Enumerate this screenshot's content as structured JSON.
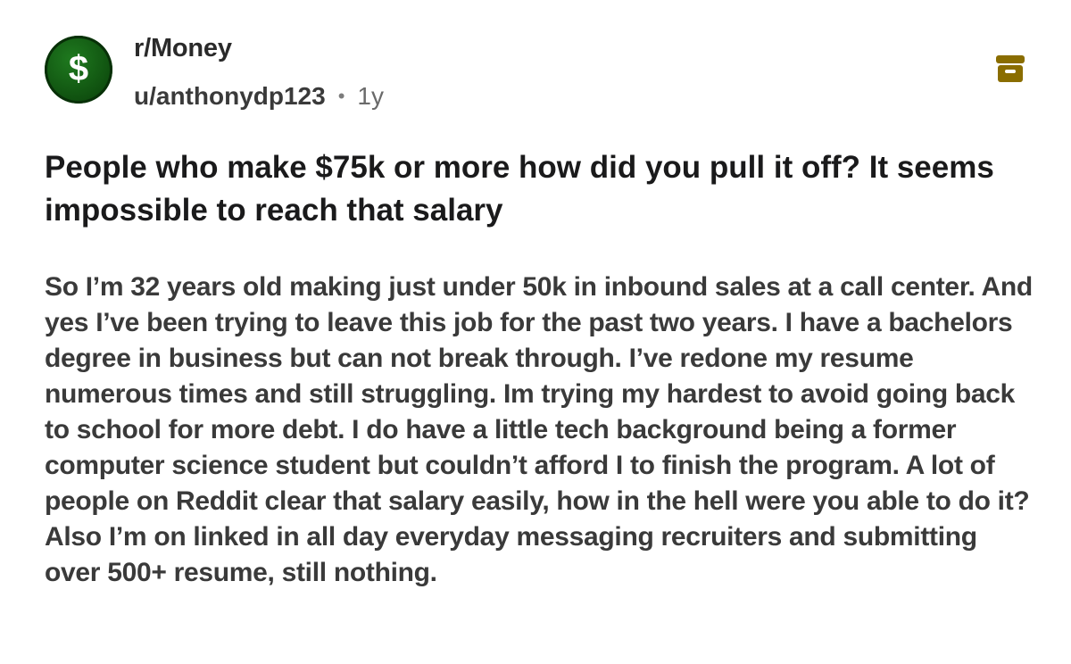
{
  "post": {
    "subreddit": "r/Money",
    "author": "u/anthonydp123",
    "separator": "•",
    "age": "1y",
    "avatar_icon": "dollar-sign-icon",
    "archive_icon": "archive-icon",
    "accent_color": "#8a6d00",
    "avatar_color": "#1a6b1a",
    "title": "People who make $75k or more how did you pull it off? It seems impossible to reach that salary",
    "body": "So I’m 32 years old making just under 50k in inbound sales at a call center. And yes I’ve been trying to leave this job for the past two years. I have a bachelors degree in business but can not break through. I’ve redone my resume numerous times and still struggling. Im trying my hardest to avoid going back to school for more debt. I do have a little tech background being a former computer science student but couldn’t afford I to finish the program. A lot of people on Reddit clear that salary easily, how in the hell were you able to do it? Also I’m on linked in all day everyday messaging recruiters and submitting over 500+ resume, still nothing."
  }
}
